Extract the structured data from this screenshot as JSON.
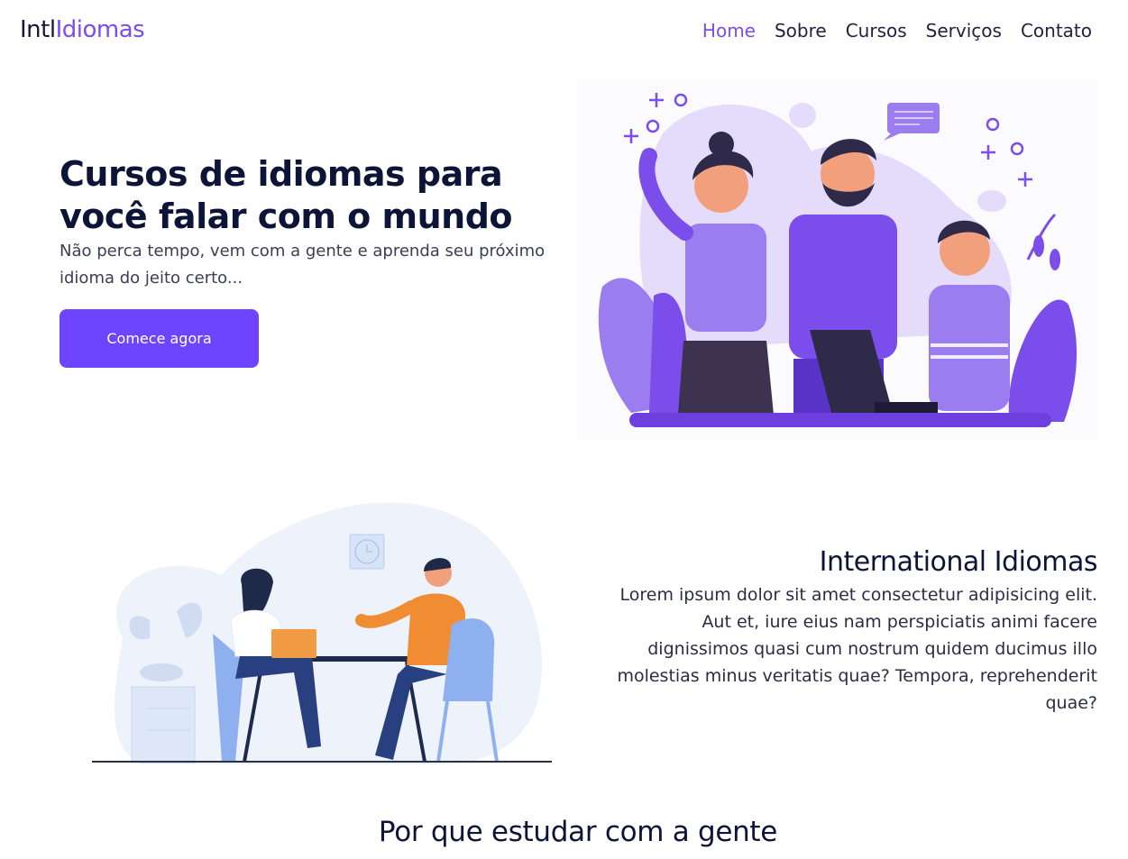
{
  "colors": {
    "accent": "#7b4dea",
    "button": "#6e44ff",
    "heading": "#0c1437"
  },
  "nav": {
    "logo_prefix": "Intl",
    "logo_accent": "Idiomas",
    "items": [
      {
        "label": "Home",
        "active": true
      },
      {
        "label": "Sobre"
      },
      {
        "label": "Cursos"
      },
      {
        "label": "Serviços"
      },
      {
        "label": "Contato"
      }
    ]
  },
  "hero": {
    "title_line1": "Cursos de idiomas para",
    "title_line2": "você falar com o mundo",
    "subtitle": "Não perca tempo, vem com a gente e aprenda seu próximo idioma do jeito certo...",
    "cta_label": "Comece agora"
  },
  "about": {
    "title": "International Idiomas",
    "body": "Lorem ipsum dolor sit amet consectetur adipisicing elit. Aut et, iure eius nam perspiciatis animi facere dignissimos quasi cum nostrum quidem ducimus illo molestias minus veritatis quae? Tempora, reprehenderit quae?"
  },
  "why": {
    "title": "Por que estudar com a gente"
  }
}
